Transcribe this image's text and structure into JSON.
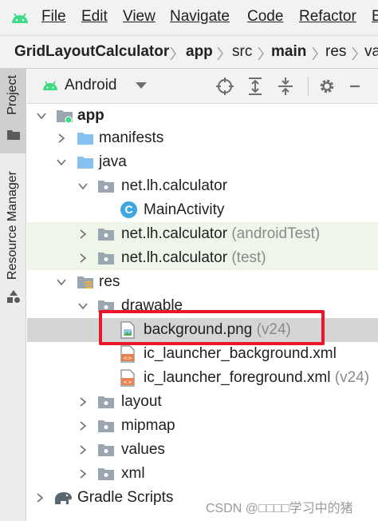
{
  "menu": {
    "items": [
      "File",
      "Edit",
      "View",
      "Navigate",
      "Code",
      "Refactor",
      "B"
    ]
  },
  "breadcrumb": [
    "GridLayoutCalculator",
    "app",
    "src",
    "main",
    "res",
    "va"
  ],
  "tool_strip": {
    "project_label": "Project",
    "resource_manager_label": "Resource Manager"
  },
  "panel": {
    "view_label": "Android"
  },
  "tree": {
    "app": "app",
    "manifests": "manifests",
    "java": "java",
    "pkg_main": "net.lh.calculator",
    "main_activity": "MainActivity",
    "class_badge": "C",
    "pkg_android_test": "net.lh.calculator",
    "pkg_android_test_suffix": "(androidTest)",
    "pkg_test": "net.lh.calculator",
    "pkg_test_suffix": "(test)",
    "res": "res",
    "drawable": "drawable",
    "background_png": "background.png",
    "background_png_suffix": "(v24)",
    "ic_bg": "ic_launcher_background.xml",
    "ic_fg": "ic_launcher_foreground.xml",
    "ic_fg_suffix": "(v24)",
    "layout": "layout",
    "mipmap": "mipmap",
    "values": "values",
    "xml": "xml",
    "gradle": "Gradle Scripts"
  },
  "watermark": "CSDN @□□□□学习中的猪",
  "colors": {
    "android_green": "#3ddc84",
    "folder_blue": "#86c1f1",
    "folder_gray": "#9aa7b0",
    "highlight_red": "#e8172b",
    "class_badge_blue": "#40a6e0"
  }
}
